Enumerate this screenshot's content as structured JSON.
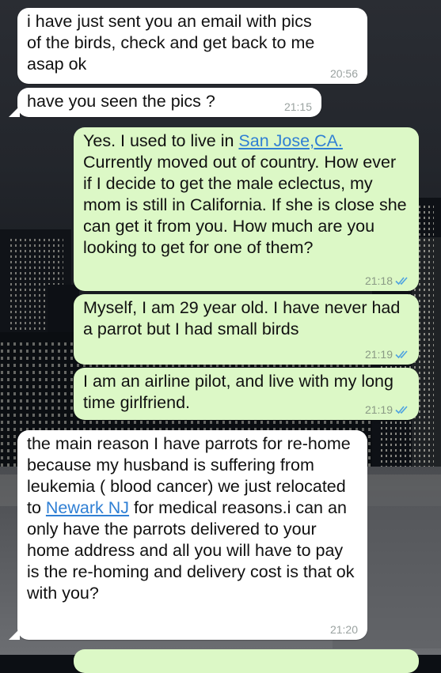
{
  "messages": [
    {
      "text": "i have just sent you an email with pics of the birds, check and get back to me asap ok",
      "time": "20:56",
      "direction": "incoming"
    },
    {
      "text": "have you seen the pics ?",
      "time": "21:15",
      "direction": "incoming"
    },
    {
      "pre": "Yes. I used to live in ",
      "link": "San Jose,CA.",
      "post": " Currently moved out of country. How ever if I decide to get the male eclectus, my mom is still in California. If she is close she can get it from you. How much are you looking to get for one of them?",
      "time": "21:18",
      "direction": "outgoing",
      "read": true
    },
    {
      "text": "Myself, I am 29 year old. I have never had a parrot but I had small birds",
      "time": "21:19",
      "direction": "outgoing",
      "read": true
    },
    {
      "text": "I am an airline pilot, and live with my long time girlfriend.",
      "time": "21:19",
      "direction": "outgoing",
      "read": true
    },
    {
      "pre": "the main reason I have parrots for re-home because my husband is suffering from  leukemia ( blood cancer) we just relocated to ",
      "link": "Newark NJ",
      "post": " for medical reasons.i   can  an only have the parrots delivered to your home address and all you will have to pay is the re-homing and delivery cost is that ok with you?",
      "time": "21:20",
      "direction": "incoming"
    }
  ],
  "colors": {
    "incoming_bubble": "#ffffff",
    "outgoing_bubble": "#dcf8c6",
    "link": "#2f7fd4",
    "read_ticks": "#4fa3e0"
  },
  "icons": [
    "double-check-icon"
  ]
}
